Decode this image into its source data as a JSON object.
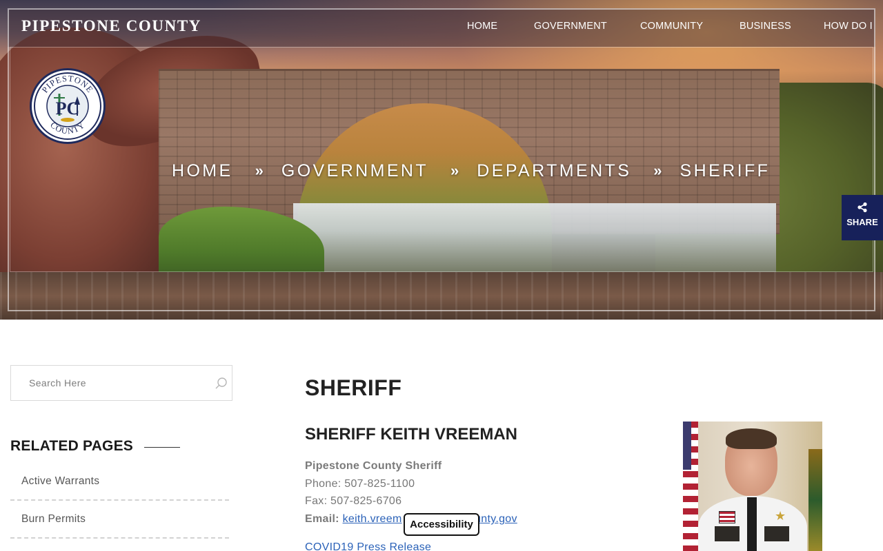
{
  "header": {
    "site_title": "PIPESTONE COUNTY",
    "seal_text_top": "PIPESTONE",
    "seal_text_bottom": "COUNTY",
    "seal_monogram": "PC",
    "nav": [
      {
        "label": "HOME"
      },
      {
        "label": "GOVERNMENT"
      },
      {
        "label": "COMMUNITY"
      },
      {
        "label": "BUSINESS"
      },
      {
        "label": "HOW DO I"
      }
    ]
  },
  "breadcrumb": {
    "items": [
      "HOME",
      "GOVERNMENT",
      "DEPARTMENTS",
      "SHERIFF"
    ],
    "separator": "»"
  },
  "share": {
    "label": "SHARE",
    "icon": "share-icon"
  },
  "sidebar": {
    "search_placeholder": "Search Here",
    "search_icon": "search-icon",
    "related_heading": "RELATED PAGES",
    "related_pages": [
      {
        "label": "Active Warrants"
      },
      {
        "label": "Burn Permits"
      }
    ]
  },
  "main": {
    "page_title": "SHERIFF",
    "sheriff_name": "SHERIFF KEITH VREEMAN",
    "org_name": "Pipestone County Sheriff",
    "phone": "Phone: 507-825-1100",
    "fax": "Fax: 507-825-6706",
    "email_label": "Email:",
    "email_text_start": "keith.vreem",
    "email_text_end": "county.gov",
    "covid_link": "COVID19 Press Release"
  },
  "accessibility": {
    "label": "Accessibility"
  },
  "colors": {
    "brand_navy": "#17215a",
    "link_blue": "#2b62b8",
    "heading": "#222222"
  }
}
